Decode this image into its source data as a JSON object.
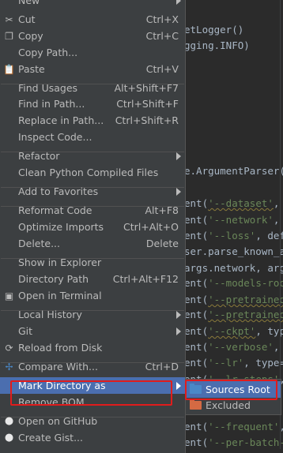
{
  "editor": {
    "lines": [
      {
        "segments": [
          {
            "t": "etLogger()",
            "c": ""
          }
        ]
      },
      {
        "segments": [
          {
            "t": "gging.INFO)",
            "c": ""
          }
        ]
      },
      {
        "segments": [
          {
            "t": "e.ArgumentParser(",
            "c": ""
          }
        ]
      },
      {
        "segments": [
          {
            "t": "ent(",
            "c": ""
          },
          {
            "t": "'--dataset'",
            "c": "str wavy"
          },
          {
            "t": ", ",
            "c": ""
          }
        ]
      },
      {
        "segments": [
          {
            "t": "ent(",
            "c": ""
          },
          {
            "t": "'--network'",
            "c": "str"
          },
          {
            "t": ", ",
            "c": ""
          }
        ]
      },
      {
        "segments": [
          {
            "t": "ent(",
            "c": ""
          },
          {
            "t": "'--loss'",
            "c": "str"
          },
          {
            "t": ", defe",
            "c": ""
          }
        ]
      },
      {
        "segments": [
          {
            "t": "ser.parse_known_ar",
            "c": ""
          }
        ]
      },
      {
        "segments": [
          {
            "t": "args.network, arg",
            "c": ""
          }
        ]
      },
      {
        "segments": [
          {
            "t": "ent(",
            "c": ""
          },
          {
            "t": "'--models-root",
            "c": "str"
          }
        ]
      },
      {
        "segments": [
          {
            "t": "ent(",
            "c": ""
          },
          {
            "t": "'--pretrained",
            "c": "str wavy"
          }
        ]
      },
      {
        "segments": [
          {
            "t": "ent(",
            "c": ""
          },
          {
            "t": "'--pretrained",
            "c": "str wavy"
          }
        ]
      },
      {
        "segments": [
          {
            "t": "ent(",
            "c": ""
          },
          {
            "t": "'--ckpt'",
            "c": "str wavy"
          },
          {
            "t": ", type",
            "c": ""
          }
        ]
      },
      {
        "segments": [
          {
            "t": "ent(",
            "c": ""
          },
          {
            "t": "'--verbose'",
            "c": "str"
          },
          {
            "t": ", ",
            "c": ""
          }
        ]
      },
      {
        "segments": [
          {
            "t": "ent(",
            "c": ""
          },
          {
            "t": "'--lr'",
            "c": "str"
          },
          {
            "t": ", type=",
            "c": ""
          }
        ]
      },
      {
        "segments": [
          {
            "t": "ent(",
            "c": ""
          },
          {
            "t": "'--lr-steps'",
            "c": "str"
          },
          {
            "t": ", ",
            "c": ""
          }
        ]
      },
      {
        "segments": [
          {
            "t": "ent(",
            "c": ""
          },
          {
            "t": "'--frequent'",
            "c": "str"
          },
          {
            "t": ", ",
            "c": ""
          }
        ]
      },
      {
        "segments": [
          {
            "t": "ent(",
            "c": ""
          },
          {
            "t": "'--per-batch-",
            "c": "str"
          }
        ]
      }
    ]
  },
  "menu": {
    "items": [
      {
        "label": "New",
        "submenu": true
      },
      {
        "label": "Cut",
        "shortcut": "Ctrl+X",
        "icon": "scissors-icon"
      },
      {
        "label": "Copy",
        "shortcut": "Ctrl+C",
        "icon": "copy-icon"
      },
      {
        "label": "Copy Path...",
        "shortcut": ""
      },
      {
        "label": "Paste",
        "shortcut": "Ctrl+V",
        "icon": "paste-icon"
      },
      {
        "label": "Find Usages",
        "shortcut": "Alt+Shift+F7"
      },
      {
        "label": "Find in Path...",
        "shortcut": "Ctrl+Shift+F"
      },
      {
        "label": "Replace in Path...",
        "shortcut": "Ctrl+Shift+R"
      },
      {
        "label": "Inspect Code...",
        "shortcut": ""
      },
      {
        "label": "Refactor",
        "submenu": true
      },
      {
        "label": "Clean Python Compiled Files",
        "shortcut": ""
      },
      {
        "label": "Add to Favorites",
        "submenu": true
      },
      {
        "label": "Reformat Code",
        "shortcut": "Alt+F8"
      },
      {
        "label": "Optimize Imports",
        "shortcut": "Ctrl+Alt+O"
      },
      {
        "label": "Delete...",
        "shortcut": "Delete"
      },
      {
        "label": "Show in Explorer",
        "shortcut": ""
      },
      {
        "label": "Directory Path",
        "shortcut": "Ctrl+Alt+F12"
      },
      {
        "label": "Open in Terminal",
        "shortcut": "",
        "icon": "terminal-icon"
      },
      {
        "label": "Local History",
        "submenu": true
      },
      {
        "label": "Git",
        "submenu": true
      },
      {
        "label": "Reload from Disk",
        "shortcut": "",
        "icon": "reload-icon"
      },
      {
        "label": "Compare With...",
        "shortcut": "Ctrl+D",
        "icon": "compare-icon"
      },
      {
        "label": "Mark Directory as",
        "submenu": true,
        "selected": true
      },
      {
        "label": "Remove BOM",
        "shortcut": ""
      },
      {
        "label": "Open on GitHub",
        "shortcut": "",
        "icon": "github-icon"
      },
      {
        "label": "Create Gist...",
        "shortcut": "",
        "icon": "github-icon"
      }
    ]
  },
  "submenu": {
    "items": [
      {
        "label": "Sources Root",
        "selected": true,
        "folder_color": "#4a88c7"
      },
      {
        "label": "Excluded",
        "folder_color": "#d46a43"
      }
    ]
  },
  "colors": {
    "menu_bg": "#3c3f41",
    "selection": "#4b6eaf",
    "highlight_box": "#e01c1c"
  }
}
